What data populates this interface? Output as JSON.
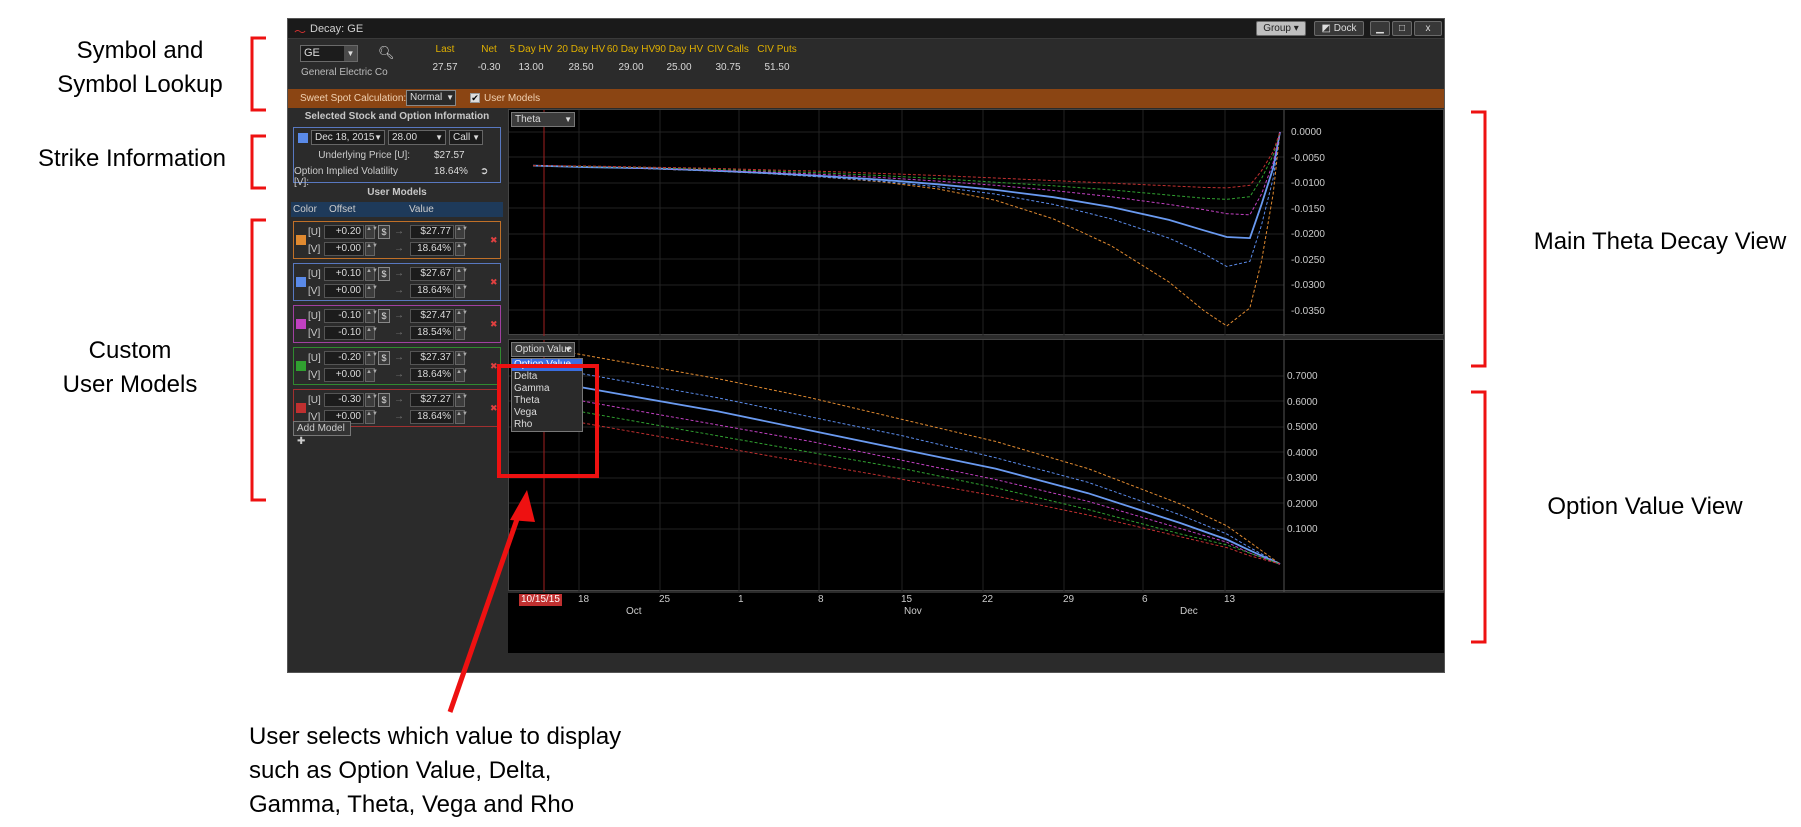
{
  "annotations": {
    "symbol_lookup_l1": "Symbol and",
    "symbol_lookup_l2": "Symbol Lookup",
    "strike_info": "Strike Information",
    "custom_l1": "Custom",
    "custom_l2": "User Models",
    "main_theta": "Main Theta Decay View",
    "option_value_view": "Option Value View",
    "bottom_l1": "User selects which value to display",
    "bottom_l2": "such as Option Value, Delta,",
    "bottom_l3": "Gamma, Theta, Vega and Rho"
  },
  "window": {
    "title": "Decay: GE",
    "group_label": "Group",
    "dock_label": "Dock",
    "minimize_glyph": "▁",
    "maximize_glyph": "□",
    "close_glyph": "x"
  },
  "symbol": {
    "value": "GE",
    "company": "General Electric Co"
  },
  "stats": [
    {
      "label": "Last",
      "value": "27.57"
    },
    {
      "label": "Net",
      "value": "-0.30"
    },
    {
      "label": "5 Day HV",
      "value": "13.00"
    },
    {
      "label": "20 Day HV",
      "value": "28.50"
    },
    {
      "label": "60 Day HV",
      "value": "29.00"
    },
    {
      "label": "90 Day HV",
      "value": "25.00"
    },
    {
      "label": "CIV Calls",
      "value": "30.75"
    },
    {
      "label": "CIV Puts",
      "value": "51.50"
    }
  ],
  "sweet_spot": {
    "label": "Sweet Spot Calculation:",
    "mode": "Normal",
    "user_models_checked": "✔",
    "user_models_label": "User Models"
  },
  "selected": {
    "title": "Selected Stock and Option Information",
    "expiry": "Dec 18, 2015",
    "strike": "28.00",
    "type": "Call",
    "underlying_label": "Underlying Price [U]:",
    "underlying_value": "$27.57",
    "iv_label": "Option Implied Volatility [V]:",
    "iv_value": "18.64%",
    "color": "#5a8ae8"
  },
  "user_models": {
    "title": "User Models",
    "col_color": "Color",
    "col_offset": "Offset",
    "col_value": "Value",
    "add_label": "Add Model ✚",
    "models": [
      {
        "color": "#e08a30",
        "border": "#c07028",
        "u_tag": "[U]",
        "v_tag": "[V]",
        "u_offset": "+0.20",
        "v_offset": "+0.00",
        "u_value": "$27.77",
        "v_value": "18.64%"
      },
      {
        "color": "#5a8ae8",
        "border": "#5878c0",
        "u_tag": "[U]",
        "v_tag": "[V]",
        "u_offset": "+0.10",
        "v_offset": "+0.00",
        "u_value": "$27.67",
        "v_value": "18.64%"
      },
      {
        "color": "#c040c0",
        "border": "#a040a0",
        "u_tag": "[U]",
        "v_tag": "[V]",
        "u_offset": "-0.10",
        "v_offset": "-0.10",
        "u_value": "$27.47",
        "v_value": "18.54%"
      },
      {
        "color": "#30a030",
        "border": "#308a30",
        "u_tag": "[U]",
        "v_tag": "[V]",
        "u_offset": "-0.20",
        "v_offset": "+0.00",
        "u_value": "$27.37",
        "v_value": "18.64%"
      },
      {
        "color": "#c03030",
        "border": "#a03030",
        "u_tag": "[U]",
        "v_tag": "[V]",
        "u_offset": "-0.30",
        "v_offset": "+0.00",
        "u_value": "$27.27",
        "v_value": "18.64%"
      }
    ]
  },
  "chart_top": {
    "selector": "Theta",
    "y_ticks": [
      "0.0000",
      "-0.0050",
      "-0.0100",
      "-0.0150",
      "-0.0200",
      "-0.0250",
      "-0.0300",
      "-0.0350"
    ]
  },
  "chart_bottom": {
    "selector": "Option Value",
    "options": [
      "Option Value",
      "Delta",
      "Gamma",
      "Theta",
      "Vega",
      "Rho"
    ],
    "y_ticks": [
      "0.7000",
      "0.6000",
      "0.5000",
      "0.4000",
      "0.3000",
      "0.2000",
      "0.1000"
    ]
  },
  "x_axis": {
    "current_date": "10/15/15",
    "day_ticks": [
      "18",
      "25",
      "1",
      "8",
      "15",
      "22",
      "29",
      "6",
      "13"
    ],
    "months": [
      "Oct",
      "Nov",
      "Dec"
    ]
  },
  "chart_data": [
    {
      "type": "line",
      "ylim": [
        -0.0375,
        0.0
      ],
      "x": [
        0,
        5,
        10,
        15,
        20,
        25,
        30,
        35,
        40,
        45,
        50,
        55,
        58,
        60,
        62,
        63,
        64,
        64.6
      ],
      "series": [
        {
          "color": "#e08a30",
          "values": [
            -0.0065,
            -0.0068,
            -0.0071,
            -0.0075,
            -0.008,
            -0.0087,
            -0.0096,
            -0.011,
            -0.0132,
            -0.0168,
            -0.022,
            -0.029,
            -0.0345,
            -0.0375,
            -0.034,
            -0.025,
            -0.012,
            0.0
          ]
        },
        {
          "color": "#5a8ae8",
          "values": [
            -0.0065,
            -0.0068,
            -0.0071,
            -0.0075,
            -0.008,
            -0.0087,
            -0.0095,
            -0.0106,
            -0.012,
            -0.014,
            -0.0168,
            -0.0205,
            -0.0235,
            -0.026,
            -0.025,
            -0.018,
            -0.009,
            0.0
          ]
        },
        {
          "color": "#6a9af0",
          "values": [
            -0.0065,
            -0.0068,
            -0.007,
            -0.0074,
            -0.0079,
            -0.0085,
            -0.0092,
            -0.0101,
            -0.0112,
            -0.0126,
            -0.0145,
            -0.017,
            -0.019,
            -0.0203,
            -0.0205,
            -0.014,
            -0.007,
            0.0
          ]
        },
        {
          "color": "#c040c0",
          "values": [
            -0.0065,
            -0.0067,
            -0.007,
            -0.0073,
            -0.0077,
            -0.0082,
            -0.0088,
            -0.0095,
            -0.0103,
            -0.0113,
            -0.0125,
            -0.014,
            -0.015,
            -0.0158,
            -0.016,
            -0.012,
            -0.006,
            0.0
          ]
        },
        {
          "color": "#30a030",
          "values": [
            -0.0065,
            -0.0067,
            -0.0069,
            -0.0072,
            -0.0075,
            -0.0079,
            -0.0084,
            -0.009,
            -0.0097,
            -0.0104,
            -0.0112,
            -0.0122,
            -0.0128,
            -0.013,
            -0.0125,
            -0.009,
            -0.0045,
            0.0
          ]
        },
        {
          "color": "#c03030",
          "values": [
            -0.0065,
            -0.0066,
            -0.0068,
            -0.007,
            -0.0073,
            -0.0076,
            -0.008,
            -0.0084,
            -0.0089,
            -0.0094,
            -0.0099,
            -0.0104,
            -0.0107,
            -0.0108,
            -0.0103,
            -0.0075,
            -0.0038,
            0.0
          ]
        }
      ]
    },
    {
      "type": "line",
      "ylim": [
        0.0,
        0.8
      ],
      "x": [
        0,
        8,
        16,
        24,
        32,
        40,
        48,
        56,
        60,
        62,
        64.6
      ],
      "series": [
        {
          "color": "#e08a30",
          "values": [
            0.8,
            0.74,
            0.68,
            0.61,
            0.53,
            0.45,
            0.35,
            0.22,
            0.14,
            0.08,
            0.0
          ]
        },
        {
          "color": "#5a8ae8",
          "values": [
            0.73,
            0.67,
            0.61,
            0.54,
            0.47,
            0.39,
            0.3,
            0.18,
            0.11,
            0.06,
            0.0
          ]
        },
        {
          "color": "#6a9af0",
          "values": [
            0.68,
            0.62,
            0.56,
            0.49,
            0.42,
            0.35,
            0.26,
            0.15,
            0.09,
            0.05,
            0.0
          ]
        },
        {
          "color": "#c040c0",
          "values": [
            0.63,
            0.57,
            0.51,
            0.45,
            0.38,
            0.31,
            0.23,
            0.13,
            0.08,
            0.04,
            0.0
          ]
        },
        {
          "color": "#30a030",
          "values": [
            0.59,
            0.53,
            0.47,
            0.41,
            0.35,
            0.28,
            0.2,
            0.11,
            0.07,
            0.04,
            0.0
          ]
        },
        {
          "color": "#c03030",
          "values": [
            0.55,
            0.49,
            0.43,
            0.37,
            0.31,
            0.25,
            0.18,
            0.1,
            0.06,
            0.03,
            0.0
          ]
        }
      ]
    }
  ]
}
